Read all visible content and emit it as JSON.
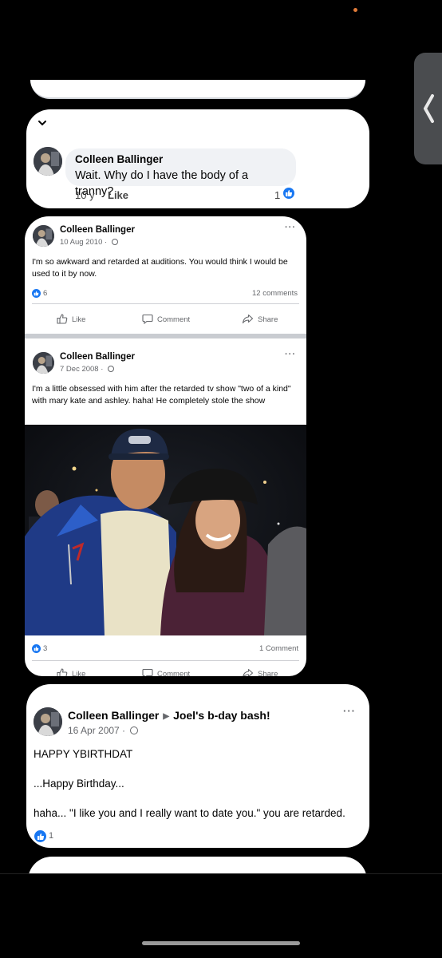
{
  "colors": {
    "background": "#000000",
    "card": "#ffffff",
    "bubble": "#f0f2f5",
    "facebook_blue": "#1877f2",
    "secondary_text": "#65676b"
  },
  "comment_card": {
    "author": "Colleen Ballinger",
    "text": "Wait. Why do I have the body of a tranny?",
    "time": "10 y",
    "like_label": "Like",
    "reaction_count": "1"
  },
  "post1": {
    "author": "Colleen Ballinger",
    "date": "10 Aug 2010 · ",
    "text": "I'm so awkward and retarded at auditions. You would think I would be used to it by now.",
    "reaction_count": "6",
    "comments": "12 comments",
    "actions": [
      "Like",
      "Comment",
      "Share"
    ]
  },
  "post2": {
    "author": "Colleen Ballinger",
    "date": "7 Dec 2008 · ",
    "text": "I'm a little obsessed with him after the retarded tv show \"two of a kind\" with mary kate and ashley. haha!  He completely stole the show",
    "reaction_count": "3",
    "comments": "1 Comment",
    "actions": [
      "Like",
      "Comment",
      "Share"
    ]
  },
  "post3": {
    "author": "Colleen Ballinger",
    "target": "Joel's b-day bash!",
    "date": "16 Apr 2007 · ",
    "lines": [
      "HAPPY YBIRTHDAT",
      "...Happy Birthday...",
      "haha... \"I like you and I really want to date you.\"  you are retarded."
    ],
    "reaction_count": "1"
  }
}
